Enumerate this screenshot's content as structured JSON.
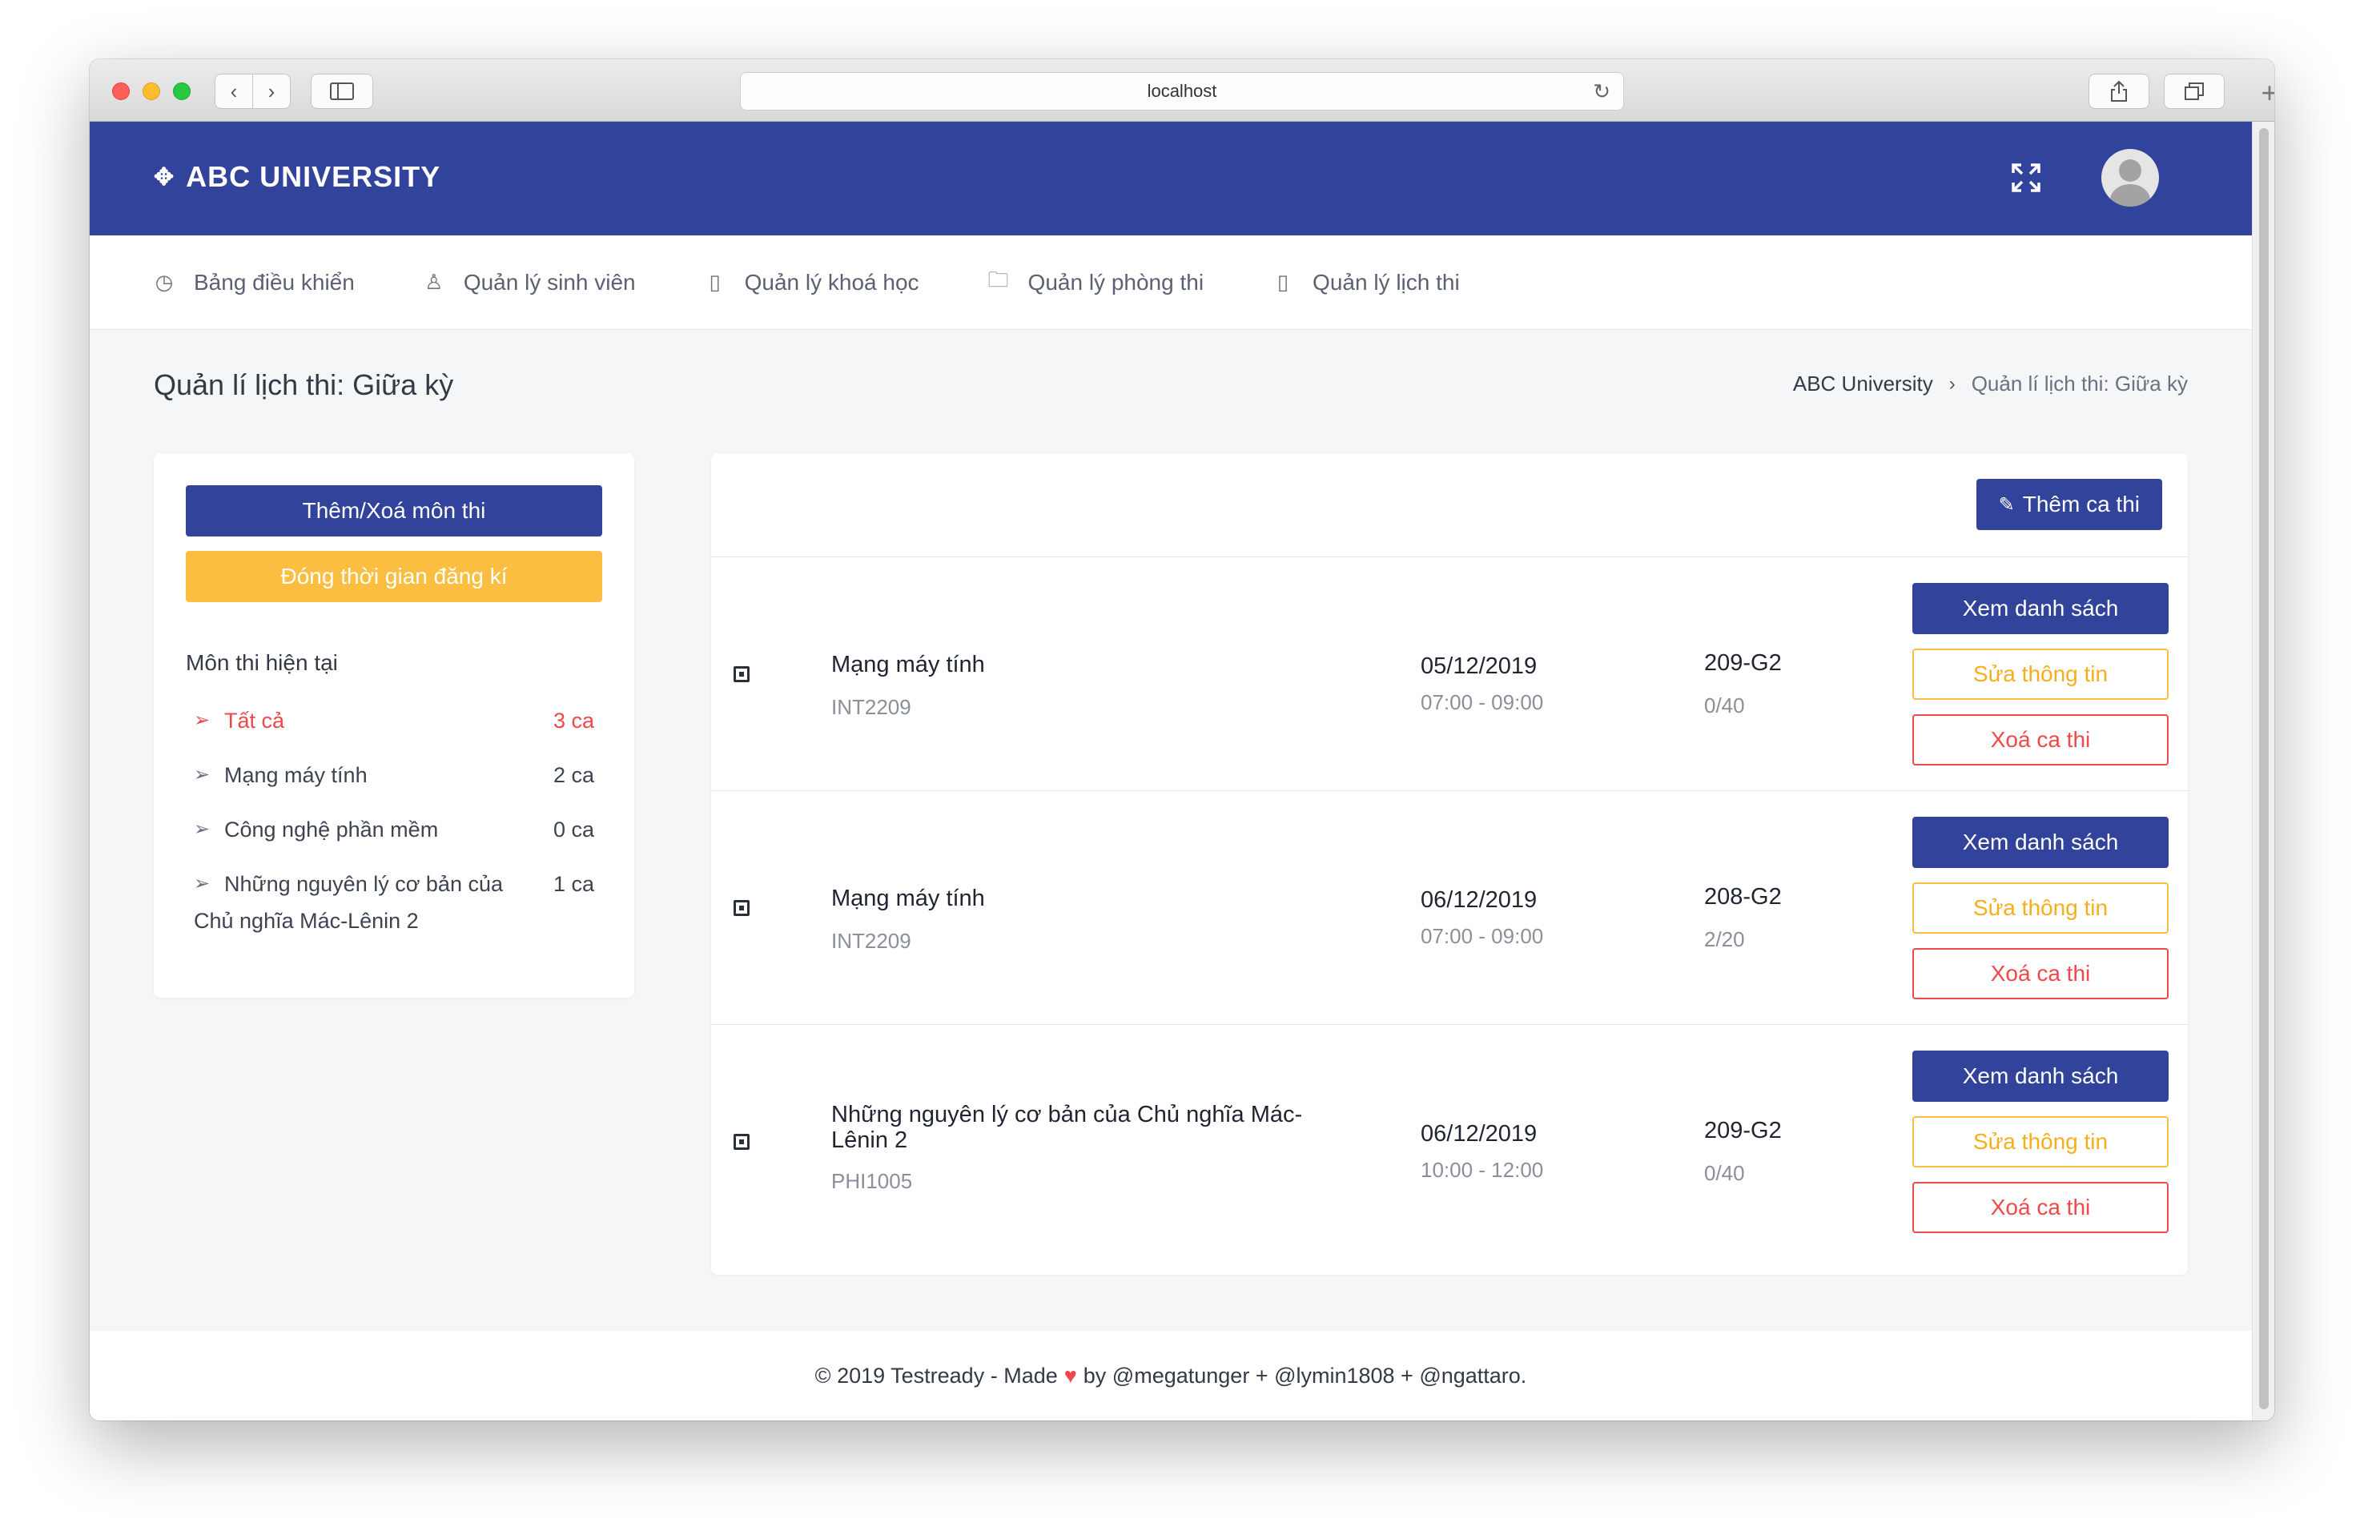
{
  "browser": {
    "url": "localhost"
  },
  "header": {
    "brand": "ABC UNIVERSITY",
    "brand_color": "#32439b"
  },
  "nav": [
    {
      "label": "Bảng điều khiển",
      "icon": "dashboard-icon"
    },
    {
      "label": "Quản lý sinh viên",
      "icon": "user-icon"
    },
    {
      "label": "Quản lý khoá học",
      "icon": "book-icon"
    },
    {
      "label": "Quản lý phòng thi",
      "icon": "folder-icon"
    },
    {
      "label": "Quản lý lịch thi",
      "icon": "calendar-icon"
    }
  ],
  "page": {
    "title": "Quản lí lịch thi: Giữa kỳ",
    "breadcrumb": [
      "ABC University",
      "Quản lí lịch thi: Giữa kỳ"
    ]
  },
  "sidebar": {
    "add_remove_label": "Thêm/Xoá môn thi",
    "close_registration_label": "Đóng thời gian đăng kí",
    "section_title": "Môn thi hiện tại",
    "subjects": [
      {
        "name": "Tất cả",
        "count": "3 ca",
        "active": true
      },
      {
        "name": "Mạng máy tính",
        "count": "2 ca",
        "active": false
      },
      {
        "name": "Công nghệ phần mềm",
        "count": "0 ca",
        "active": false
      },
      {
        "name": "Những nguyên lý cơ bản của",
        "name_cont": "Chủ nghĩa Mác-Lênin 2",
        "count": "1 ca",
        "active": false
      }
    ]
  },
  "main": {
    "add_session_label": "Thêm ca thi",
    "sessions": [
      {
        "subject": "Mạng máy tính",
        "code": "INT2209",
        "date": "05/12/2019",
        "time": "07:00 - 09:00",
        "room": "209-G2",
        "capacity": "0/40"
      },
      {
        "subject": "Mạng máy tính",
        "code": "INT2209",
        "date": "06/12/2019",
        "time": "07:00 - 09:00",
        "room": "208-G2",
        "capacity": "2/20"
      },
      {
        "subject": "Những nguyên lý cơ bản của Chủ nghĩa Mác-Lênin 2",
        "code": "PHI1005",
        "date": "06/12/2019",
        "time": "10:00 - 12:00",
        "room": "209-G2",
        "capacity": "0/40"
      }
    ],
    "view_label": "Xem danh sách",
    "edit_label": "Sửa thông tin",
    "delete_label": "Xoá ca thi"
  },
  "footer": {
    "left": "© 2019 Testready - Made",
    "right": "by @megatunger + @lymin1808 + @ngattaro."
  }
}
